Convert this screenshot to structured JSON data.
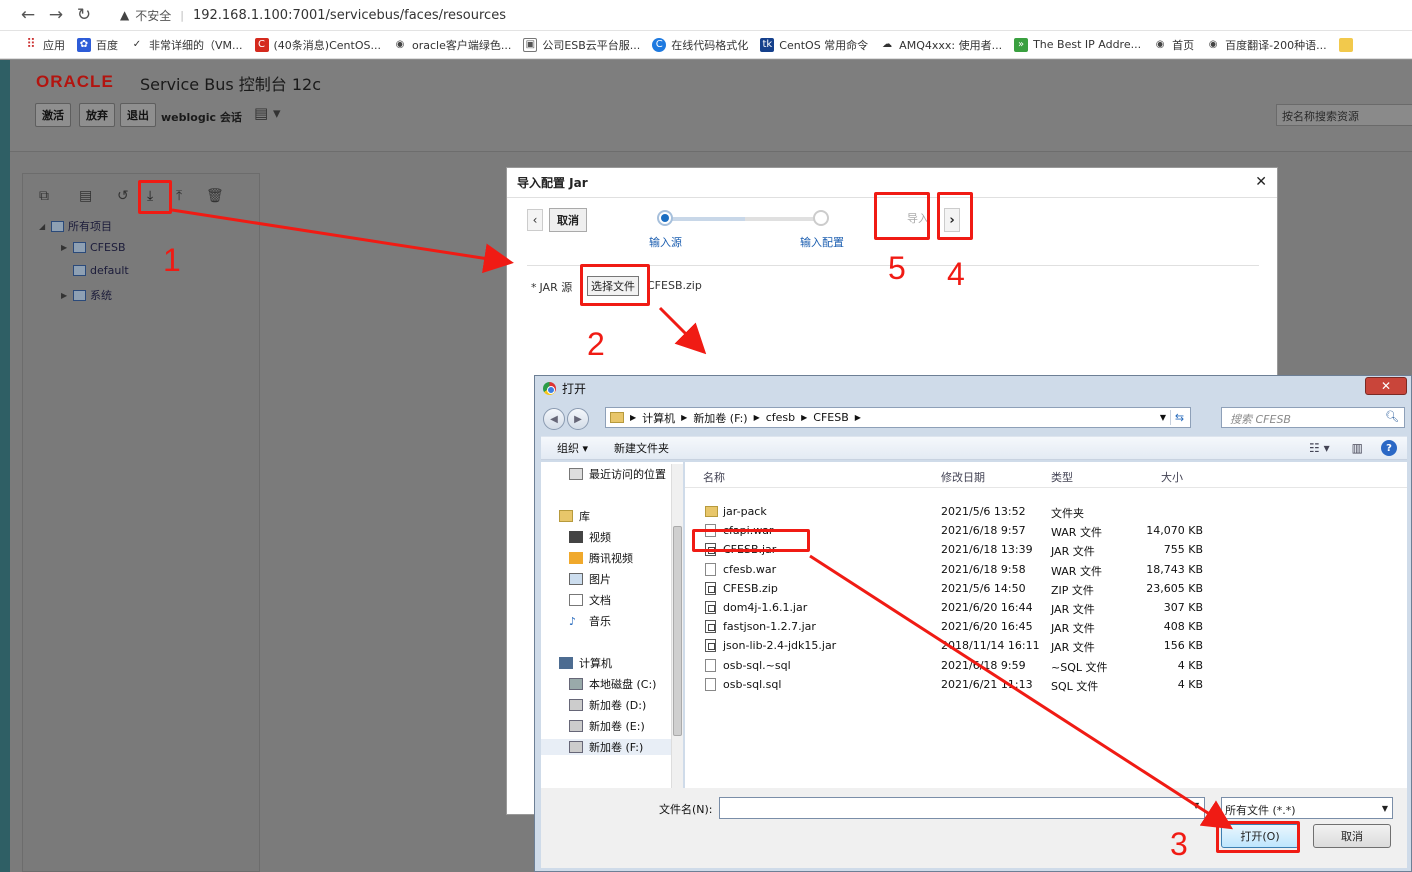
{
  "browser": {
    "security_label": "不安全",
    "url": "192.168.1.100:7001/servicebus/faces/resources",
    "bookmarks": [
      "应用",
      "百度",
      "非常详细的（VM...",
      "(40条消息)CentOS...",
      "oracle客户端绿色...",
      "公司ESB云平台服...",
      "在线代码格式化",
      "CentOS 常用命令",
      "AMQ4xxx: 使用者...",
      "The Best IP Addre...",
      "首页",
      "百度翻译-200种语..."
    ]
  },
  "app": {
    "logo": "ORACLE",
    "title": "Service Bus 控制台 12c",
    "activate": "激活",
    "discard": "放弃",
    "exit": "退出",
    "session": "weblogic 会话",
    "search_placeholder": "按名称搜索资源"
  },
  "tree": {
    "root": "所有项目",
    "items": [
      "CFESB",
      "default",
      "系统"
    ]
  },
  "import_dialog": {
    "title": "导入配置 Jar",
    "cancel": "取消",
    "step1": "输入源",
    "step2": "输入配置",
    "import": "导入",
    "jar_label": "JAR 源",
    "choose_file": "选择文件",
    "file_name": "CFESB.zip"
  },
  "open_dialog": {
    "title": "打开",
    "path": [
      "计算机",
      "新加卷 (F:)",
      "cfesb",
      "CFESB"
    ],
    "search_placeholder": "搜索 CFESB",
    "organize": "组织 ▾",
    "new_folder": "新建文件夹",
    "sidebar": [
      "最近访问的位置",
      "库",
      "视频",
      "腾讯视频",
      "图片",
      "文档",
      "音乐",
      "计算机",
      "本地磁盘 (C:)",
      "新加卷 (D:)",
      "新加卷 (E:)",
      "新加卷 (F:)"
    ],
    "columns": [
      "名称",
      "修改日期",
      "类型",
      "大小"
    ],
    "files": [
      {
        "name": "jar-pack",
        "date": "2021/5/6 13:52",
        "type": "文件夹",
        "size": "",
        "kind": "folder"
      },
      {
        "name": "cfapi.war",
        "date": "2021/6/18 9:57",
        "type": "WAR 文件",
        "size": "14,070 KB",
        "kind": "file"
      },
      {
        "name": "CFESB.jar",
        "date": "2021/6/18 13:39",
        "type": "JAR 文件",
        "size": "755 KB",
        "kind": "jar"
      },
      {
        "name": "cfesb.war",
        "date": "2021/6/18 9:58",
        "type": "WAR 文件",
        "size": "18,743 KB",
        "kind": "file"
      },
      {
        "name": "CFESB.zip",
        "date": "2021/5/6 14:50",
        "type": "ZIP 文件",
        "size": "23,605 KB",
        "kind": "jar"
      },
      {
        "name": "dom4j-1.6.1.jar",
        "date": "2021/6/20 16:44",
        "type": "JAR 文件",
        "size": "307 KB",
        "kind": "jar"
      },
      {
        "name": "fastjson-1.2.7.jar",
        "date": "2021/6/20 16:45",
        "type": "JAR 文件",
        "size": "408 KB",
        "kind": "jar"
      },
      {
        "name": "json-lib-2.4-jdk15.jar",
        "date": "2018/11/14 16:11",
        "type": "JAR 文件",
        "size": "156 KB",
        "kind": "jar"
      },
      {
        "name": "osb-sql.~sql",
        "date": "2021/6/18 9:59",
        "type": "~SQL 文件",
        "size": "4 KB",
        "kind": "file"
      },
      {
        "name": "osb-sql.sql",
        "date": "2021/6/21 11:13",
        "type": "SQL 文件",
        "size": "4 KB",
        "kind": "file"
      }
    ],
    "filename_label": "文件名(N):",
    "filename_value": "",
    "filetype": "所有文件 (*.*)",
    "open": "打开(O)",
    "cancel": "取消"
  },
  "annotations": [
    "1",
    "2",
    "3",
    "4",
    "5"
  ],
  "colors": {
    "annotation": "#f01b14",
    "oracle_red": "#b3140f",
    "link_blue": "#1b5eb0"
  }
}
